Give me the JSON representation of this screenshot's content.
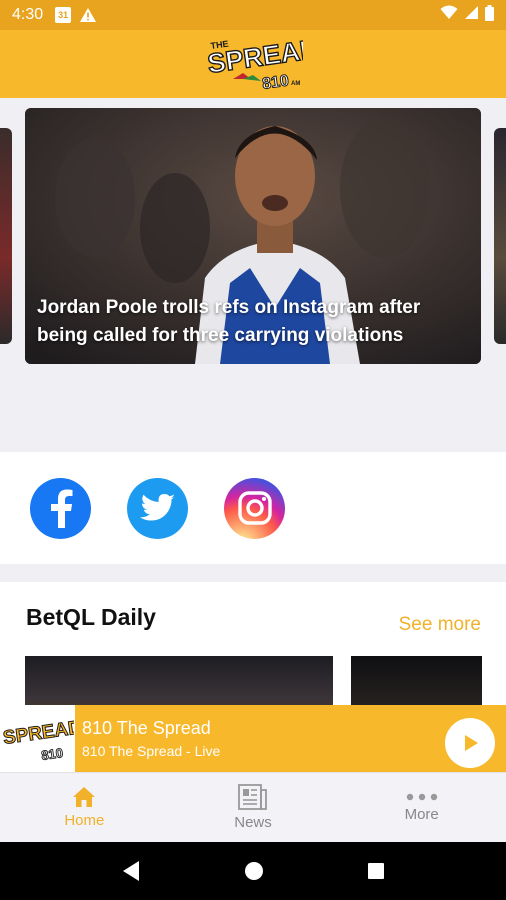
{
  "status_bar": {
    "time": "4:30",
    "calendar_day": "31",
    "icons": [
      "calendar-icon",
      "warning-icon",
      "wifi-icon",
      "signal-icon",
      "battery-icon"
    ]
  },
  "header": {
    "logo_top": "THE",
    "logo_main": "SPREAD",
    "logo_num": "810",
    "logo_am": "AM"
  },
  "carousel": {
    "headline": "Jordan Poole trolls refs on Instagram after being called for three carrying violations"
  },
  "social": {
    "icons": [
      "facebook-icon",
      "twitter-icon",
      "instagram-icon"
    ]
  },
  "betql": {
    "title": "BetQL Daily",
    "see_more": "See more"
  },
  "player": {
    "station_name": "810 The Spread",
    "station_sub": "810 The Spread - Live"
  },
  "bottom_nav": {
    "items": [
      {
        "label": "Home",
        "icon": "home-icon",
        "active": true
      },
      {
        "label": "News",
        "icon": "news-icon",
        "active": false
      },
      {
        "label": "More",
        "icon": "more-icon",
        "active": false
      }
    ]
  },
  "colors": {
    "brand_yellow": "#f8b82c",
    "status_bar": "#e8a41e",
    "accent_text": "#f2b12a",
    "facebook": "#1877f2",
    "twitter": "#1d9bf0"
  }
}
